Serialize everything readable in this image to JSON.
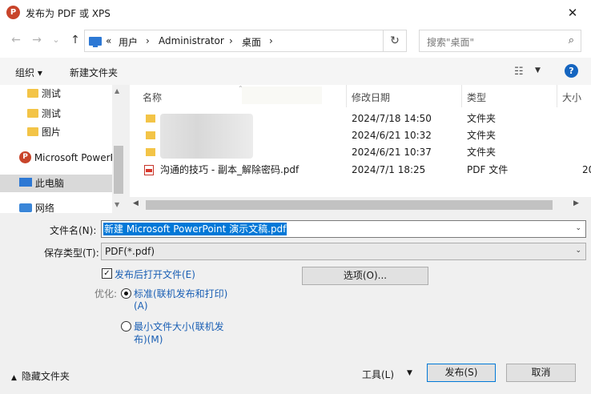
{
  "window": {
    "title": "发布为 PDF 或 XPS",
    "app_icon": "P",
    "close_label": "✕"
  },
  "nav": {
    "back_icon": "←",
    "forward_icon": "→",
    "dropdown_icon": "⌄",
    "up_icon": "↑",
    "overflow": "«",
    "breadcrumb": [
      "用户",
      "Administrator",
      "桌面"
    ],
    "separator": "›",
    "refresh_icon": "↻",
    "search_placeholder": "搜索\"桌面\"",
    "search_icon": "⌕"
  },
  "toolbar": {
    "organize": "组织 ▾",
    "new_folder": "新建文件夹",
    "view_icon": "☷",
    "view_dd": "▼",
    "help": "?"
  },
  "sidebar": {
    "items": [
      {
        "label": "测试",
        "icon": "folder-icon"
      },
      {
        "label": "测试",
        "icon": "folder-icon"
      },
      {
        "label": "图片",
        "icon": "folder-icon"
      },
      {
        "label": "Microsoft PowerPoint",
        "icon": "powerpoint-icon"
      },
      {
        "label": "此电脑",
        "icon": "computer-icon"
      },
      {
        "label": "网络",
        "icon": "network-icon"
      }
    ]
  },
  "filelist": {
    "columns": [
      "名称",
      "修改日期",
      "类型",
      "大小"
    ],
    "rows": [
      {
        "name": "",
        "date": "2024/7/18 14:50",
        "type": "文件夹",
        "size": "",
        "icon": "folder-icon"
      },
      {
        "name": "",
        "date": "2024/6/21 10:32",
        "type": "文件夹",
        "size": "",
        "icon": "folder-icon"
      },
      {
        "name": "",
        "date": "2024/6/21 10:37",
        "type": "文件夹",
        "size": "",
        "icon": "folder-icon"
      },
      {
        "name": "沟通的技巧 - 副本_解除密码.pdf",
        "date": "2024/7/1 18:25",
        "type": "PDF 文件",
        "size": "20",
        "icon": "pdf-icon"
      }
    ]
  },
  "form": {
    "filename_label": "文件名(N):",
    "filename_value": "新建 Microsoft PowerPoint 演示文稿.pdf",
    "filetype_label": "保存类型(T):",
    "filetype_value": "PDF(*.pdf)",
    "open_after_label": "发布后打开文件(E)",
    "open_after_checked": true,
    "check_mark": "✓",
    "options_button": "选项(O)...",
    "optimize_label": "优化:",
    "radio_standard_line1": "标准(联机发布和打印)",
    "radio_standard_line2": "(A)",
    "radio_min_line1": "最小文件大小(联机发",
    "radio_min_line2": "布)(M)",
    "selected_optimization": "standard"
  },
  "footer": {
    "hide_folders": "隐藏文件夹",
    "hide_caret": "▲",
    "tools": "工具(L)",
    "tools_dd": "▼",
    "publish": "发布(S)",
    "cancel": "取消"
  }
}
